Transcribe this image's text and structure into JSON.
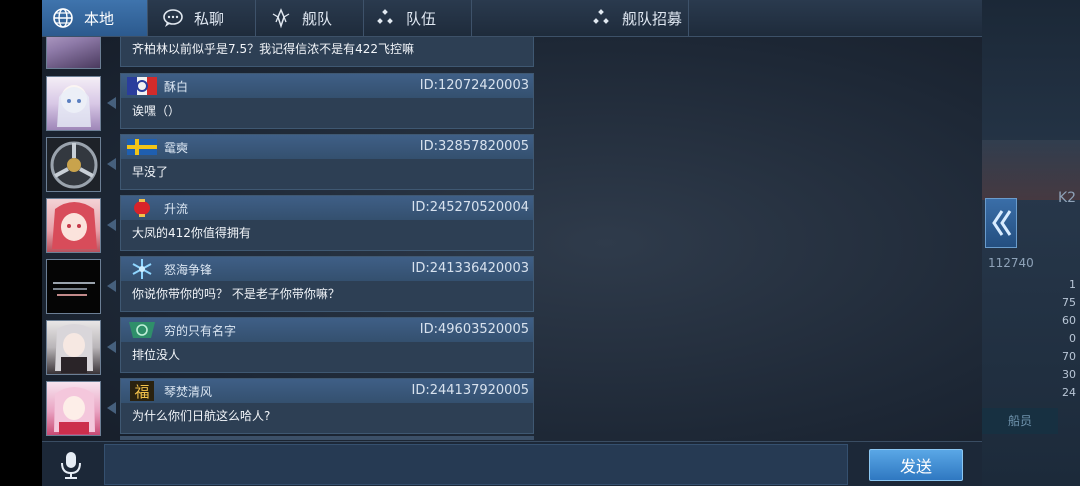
{
  "tabs": [
    {
      "label": "本地",
      "icon": "globe-icon",
      "active": true
    },
    {
      "label": "私聊",
      "icon": "chat-bubble-icon",
      "active": false
    },
    {
      "label": "舰队",
      "icon": "fleet-emblem-icon",
      "active": false
    },
    {
      "label": "队伍",
      "icon": "team-dots-icon",
      "active": false
    },
    {
      "label": "舰队招募",
      "icon": "recruit-dots-icon",
      "active": false
    }
  ],
  "messages": [
    {
      "name": "",
      "id": "",
      "text": "齐柏林以前似乎是7.5？我记得信浓不是有422飞控嘛",
      "badge": "",
      "avatar": "avatar-purple-tree"
    },
    {
      "name": "酥白",
      "id": "ID:12072420003",
      "text": "诶嘿（）",
      "badge": "france-flag-icon",
      "avatar": "avatar-white-hair-girl"
    },
    {
      "name": "鼋奭",
      "id": "ID:32857820005",
      "text": "早没了",
      "badge": "sweden-flag-icon",
      "avatar": "avatar-crosshair-emblem"
    },
    {
      "name": "升流",
      "id": "ID:245270520004",
      "text": "大凤的412你值得拥有",
      "badge": "lantern-icon",
      "avatar": "avatar-pink-hair-girl"
    },
    {
      "name": "怒海争锋",
      "id": "ID:241336420003",
      "text": "你说你带你的吗？  不是老子你带你嘛？",
      "badge": "snowflake-icon",
      "avatar": "avatar-dark-text"
    },
    {
      "name": "穷的只有名字",
      "id": "ID:49603520005",
      "text": "排位没人",
      "badge": "green-emblem-icon",
      "avatar": "avatar-silver-hair-girl"
    },
    {
      "name": "琴焚清风",
      "id": "ID:244137920005",
      "text": "为什么你们日航这么哈人?",
      "badge": "fu-character-icon",
      "avatar": "avatar-pink-outfit-girl"
    }
  ],
  "input": {
    "placeholder": ""
  },
  "send_label": "发送",
  "background": {
    "power": "112740",
    "k2": "K2",
    "crew_label": "船员",
    "stats": [
      "1",
      "75",
      "60",
      "0",
      "70",
      "30",
      "24"
    ]
  },
  "colors": {
    "accent": "#3f74ad",
    "send": "#4a97d8",
    "bubble_head": "#3f5f87"
  }
}
